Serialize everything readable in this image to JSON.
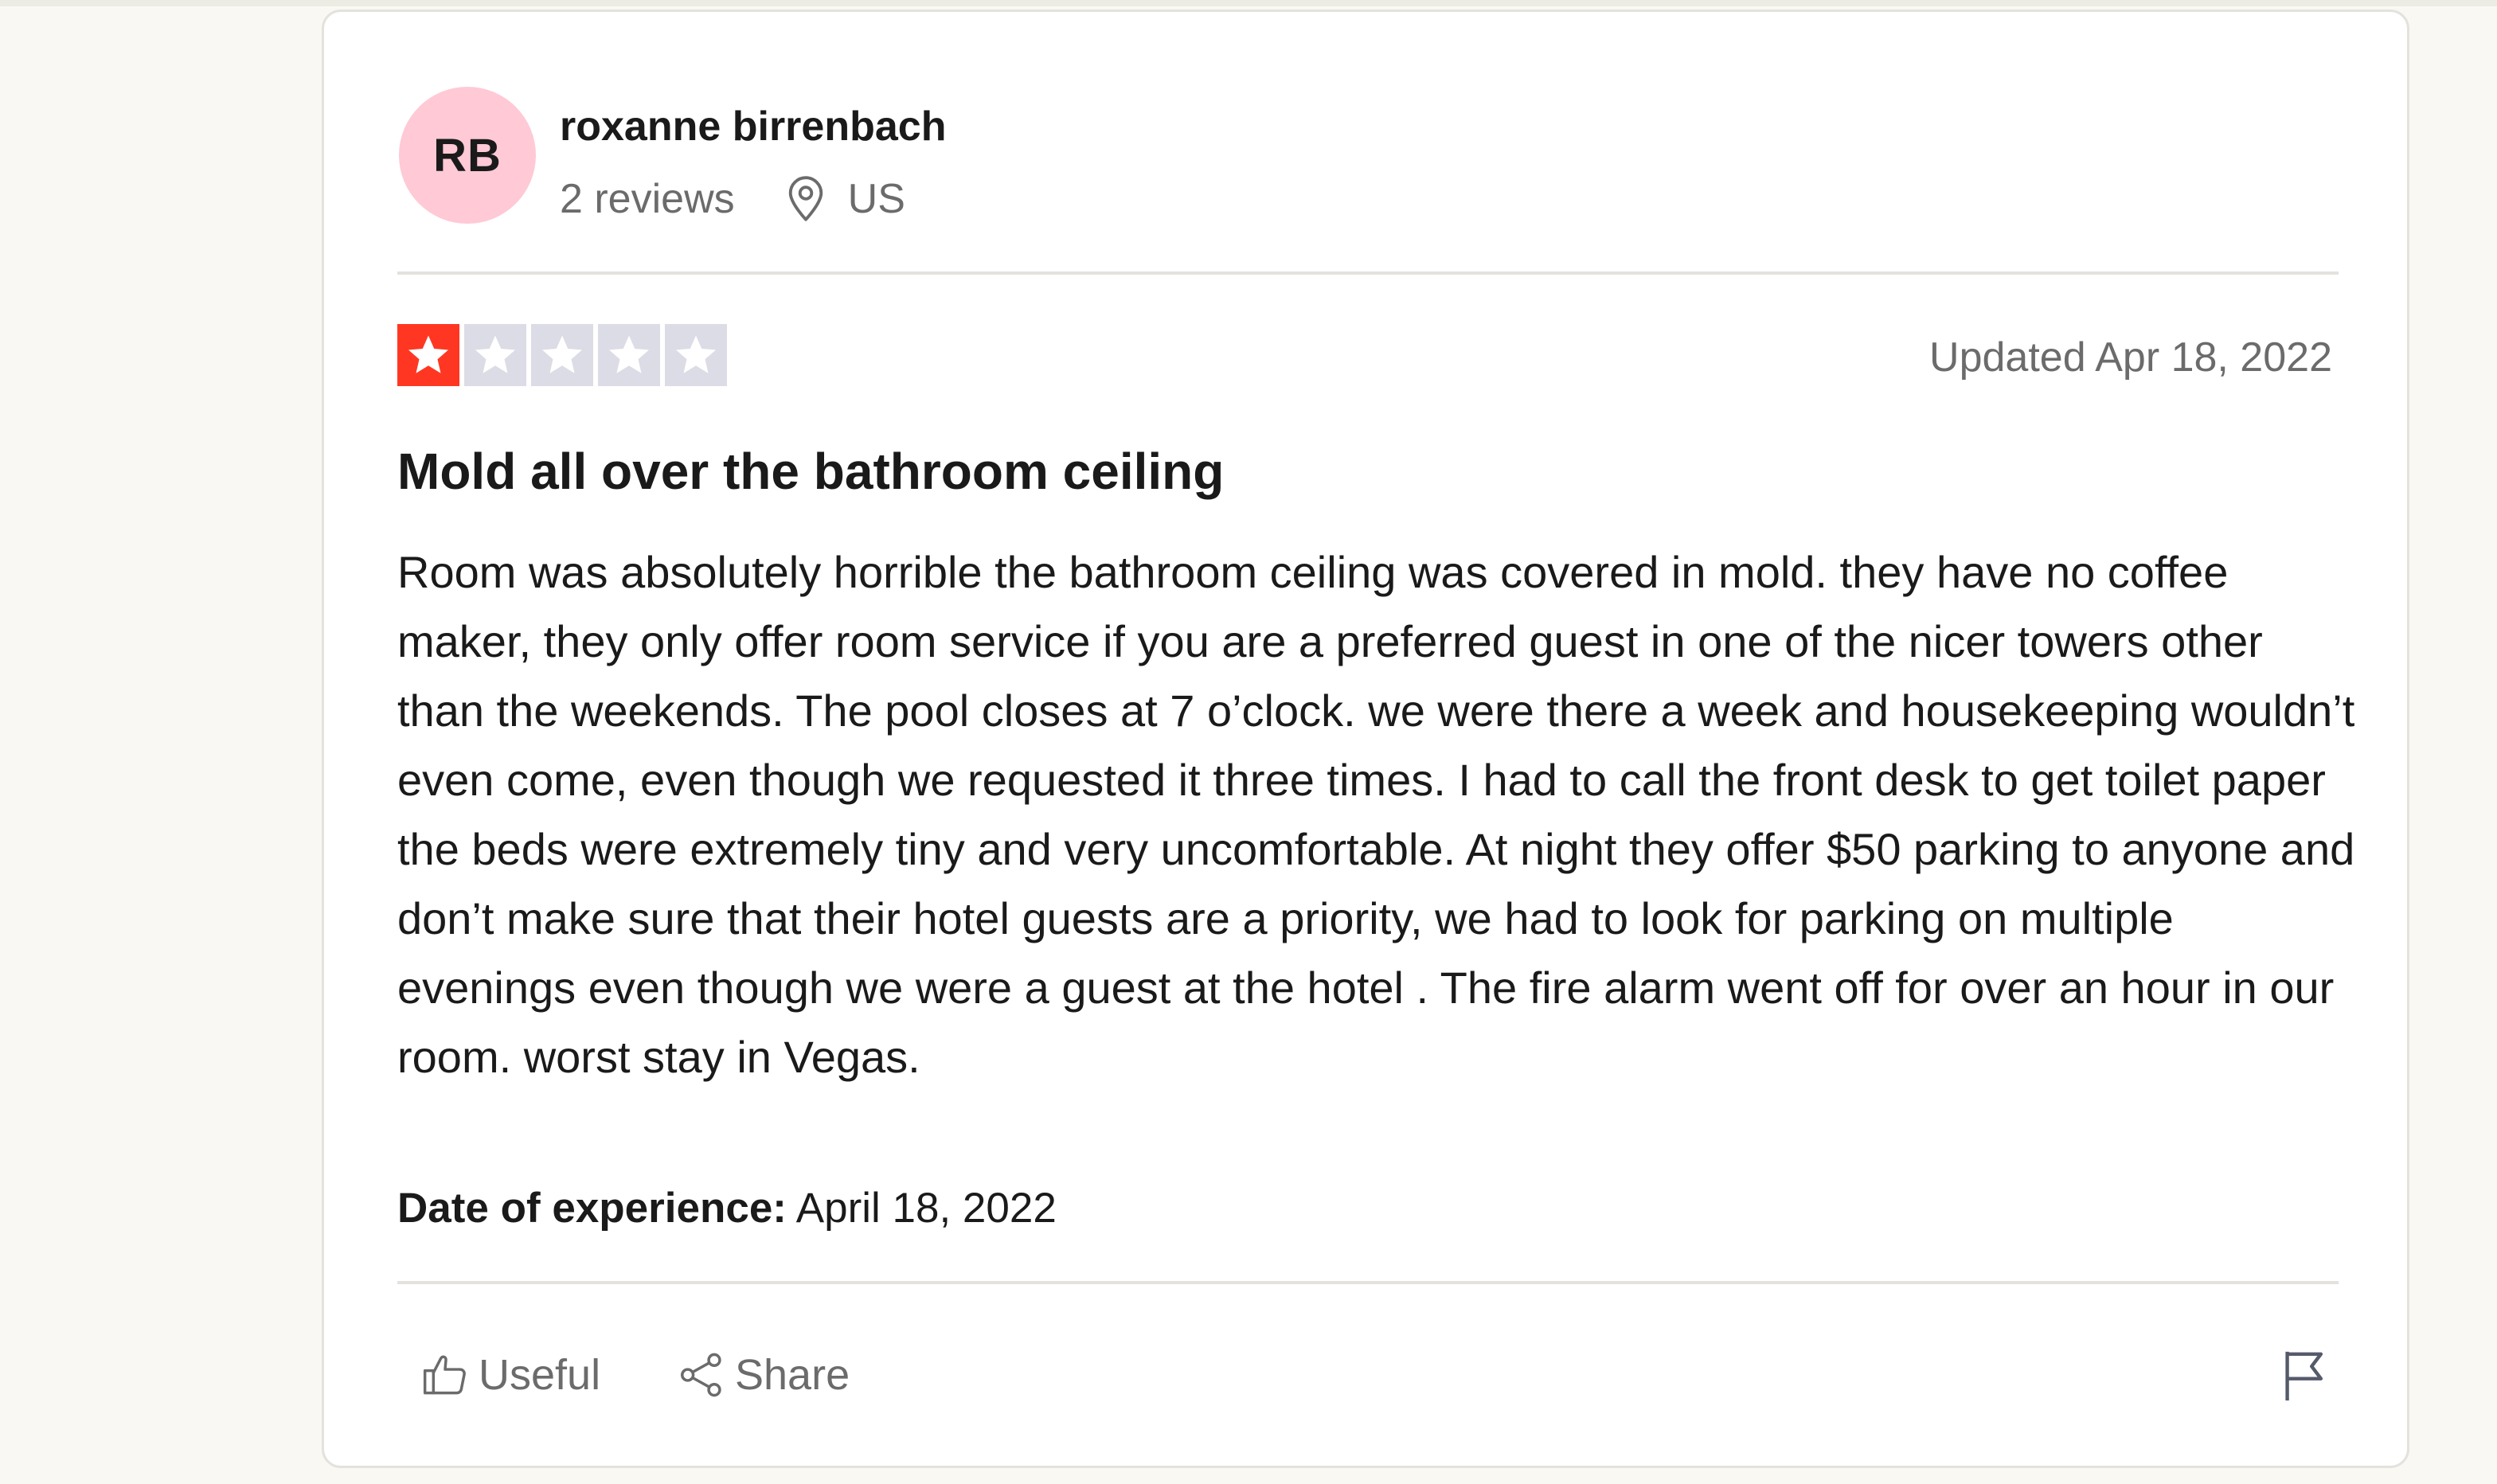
{
  "reviewer": {
    "initials": "RB",
    "name": "roxanne birrenbach",
    "review_count": "2 reviews",
    "country": "US"
  },
  "review": {
    "rating": 1,
    "max_rating": 5,
    "updated": "Updated Apr 18, 2022",
    "title": "Mold all over the bathroom ceiling",
    "body": "Room was absolutely horrible the bathroom ceiling was covered in mold. they have no coffee maker, they only offer room service if you are a preferred guest in one of the nicer towers other than the weekends. The pool closes at 7 o’clock. we were there a week and housekeeping wouldn’t even come, even though we requested it three times. I had to call the front desk to get toilet paper the beds were extremely tiny and very uncomfortable. At night they offer $50 parking to anyone and don’t make sure that their hotel guests are a priority, we had to look for parking on multiple evenings even though we were a guest at the hotel . The fire alarm went off for over an hour in our room. worst stay in Vegas.",
    "experience_label": "Date of experience:",
    "experience_date": "April 18, 2022"
  },
  "actions": {
    "useful_label": "Useful",
    "share_label": "Share"
  },
  "icons": {
    "location": "location-pin-icon",
    "star": "star-icon",
    "useful": "thumbs-up-icon",
    "share": "share-icon",
    "flag": "flag-icon"
  },
  "colors": {
    "page_background": "#f9f8f3",
    "card_background": "#ffffff",
    "avatar_background": "#ffc9d6",
    "star_filled": "#ff3722",
    "star_empty": "#dcdce6",
    "secondary_text": "#6b6b6b",
    "divider": "#e3e2dc"
  }
}
